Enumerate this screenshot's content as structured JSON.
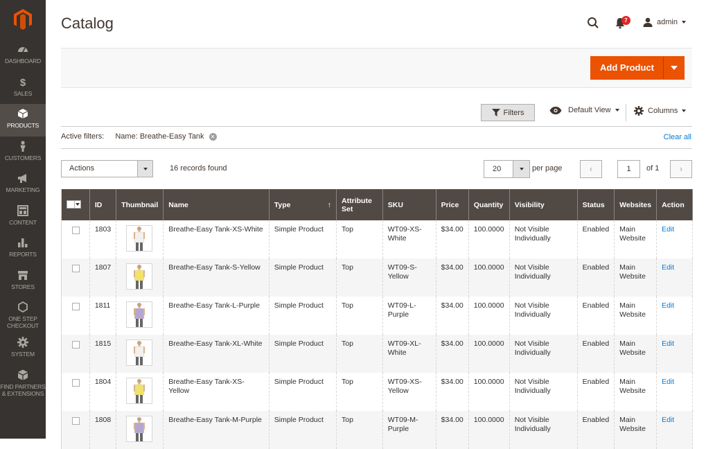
{
  "sidebar": {
    "items": [
      {
        "label": "DASHBOARD",
        "icon": "dashboard-icon"
      },
      {
        "label": "SALES",
        "icon": "dollar-icon"
      },
      {
        "label": "PRODUCTS",
        "icon": "cube-icon",
        "active": true
      },
      {
        "label": "CUSTOMERS",
        "icon": "person-icon"
      },
      {
        "label": "MARKETING",
        "icon": "megaphone-icon"
      },
      {
        "label": "CONTENT",
        "icon": "layout-icon"
      },
      {
        "label": "REPORTS",
        "icon": "bar-chart-icon"
      },
      {
        "label": "STORES",
        "icon": "store-icon"
      },
      {
        "label": "ONE STEP CHECKOUT",
        "icon": "hexagon-icon"
      },
      {
        "label": "SYSTEM",
        "icon": "gear-icon"
      },
      {
        "label": "FIND PARTNERS & EXTENSIONS",
        "icon": "box-icon"
      }
    ]
  },
  "header": {
    "title": "Catalog",
    "notification_count": "7",
    "user": "admin"
  },
  "page_actions": {
    "add_product": "Add Product"
  },
  "toolbar": {
    "filters": "Filters",
    "view": "Default View",
    "columns": "Columns",
    "active_filters_label": "Active filters:",
    "active_filter_value": "Name: Breathe-Easy Tank",
    "clear_all": "Clear all",
    "actions": "Actions",
    "records": "16 records found",
    "per_page_value": "20",
    "per_page_label": "per page",
    "page_value": "1",
    "page_of": "of 1"
  },
  "table": {
    "columns": [
      "ID",
      "Thumbnail",
      "Name",
      "Type",
      "Attribute Set",
      "SKU",
      "Price",
      "Quantity",
      "Visibility",
      "Status",
      "Websites",
      "Action"
    ],
    "sort_indicator": "↑",
    "rows": [
      {
        "id": "1803",
        "name": "Breathe-Easy Tank-XS-White",
        "type": "Simple Product",
        "attr": "Top",
        "sku": "WT09-XS-White",
        "price": "$34.00",
        "qty": "100.0000",
        "visibility": "Not Visible Individually",
        "status": "Enabled",
        "websites": "Main Website",
        "action": "Edit",
        "color": "#f4f1ea"
      },
      {
        "id": "1807",
        "name": "Breathe-Easy Tank-S-Yellow",
        "type": "Simple Product",
        "attr": "Top",
        "sku": "WT09-S-Yellow",
        "price": "$34.00",
        "qty": "100.0000",
        "visibility": "Not Visible Individually",
        "status": "Enabled",
        "websites": "Main Website",
        "action": "Edit",
        "color": "#f1e36a"
      },
      {
        "id": "1811",
        "name": "Breathe-Easy Tank-L-Purple",
        "type": "Simple Product",
        "attr": "Top",
        "sku": "WT09-L-Purple",
        "price": "$34.00",
        "qty": "100.0000",
        "visibility": "Not Visible Individually",
        "status": "Enabled",
        "websites": "Main Website",
        "action": "Edit",
        "color": "#b6a6cf"
      },
      {
        "id": "1815",
        "name": "Breathe-Easy Tank-XL-White",
        "type": "Simple Product",
        "attr": "Top",
        "sku": "WT09-XL-White",
        "price": "$34.00",
        "qty": "100.0000",
        "visibility": "Not Visible Individually",
        "status": "Enabled",
        "websites": "Main Website",
        "action": "Edit",
        "color": "#f4f1ea"
      },
      {
        "id": "1804",
        "name": "Breathe-Easy Tank-XS-Yellow",
        "type": "Simple Product",
        "attr": "Top",
        "sku": "WT09-XS-Yellow",
        "price": "$34.00",
        "qty": "100.0000",
        "visibility": "Not Visible Individually",
        "status": "Enabled",
        "websites": "Main Website",
        "action": "Edit",
        "color": "#f1e36a"
      },
      {
        "id": "1808",
        "name": "Breathe-Easy Tank-M-Purple",
        "type": "Simple Product",
        "attr": "Top",
        "sku": "WT09-M-Purple",
        "price": "$34.00",
        "qty": "100.0000",
        "visibility": "Not Visible Individually",
        "status": "Enabled",
        "websites": "Main Website",
        "action": "Edit",
        "color": "#b6a6cf"
      }
    ]
  },
  "colors": {
    "accent": "#eb5202",
    "sidebar": "#373330",
    "header_row": "#514943",
    "link": "#007bdb"
  }
}
